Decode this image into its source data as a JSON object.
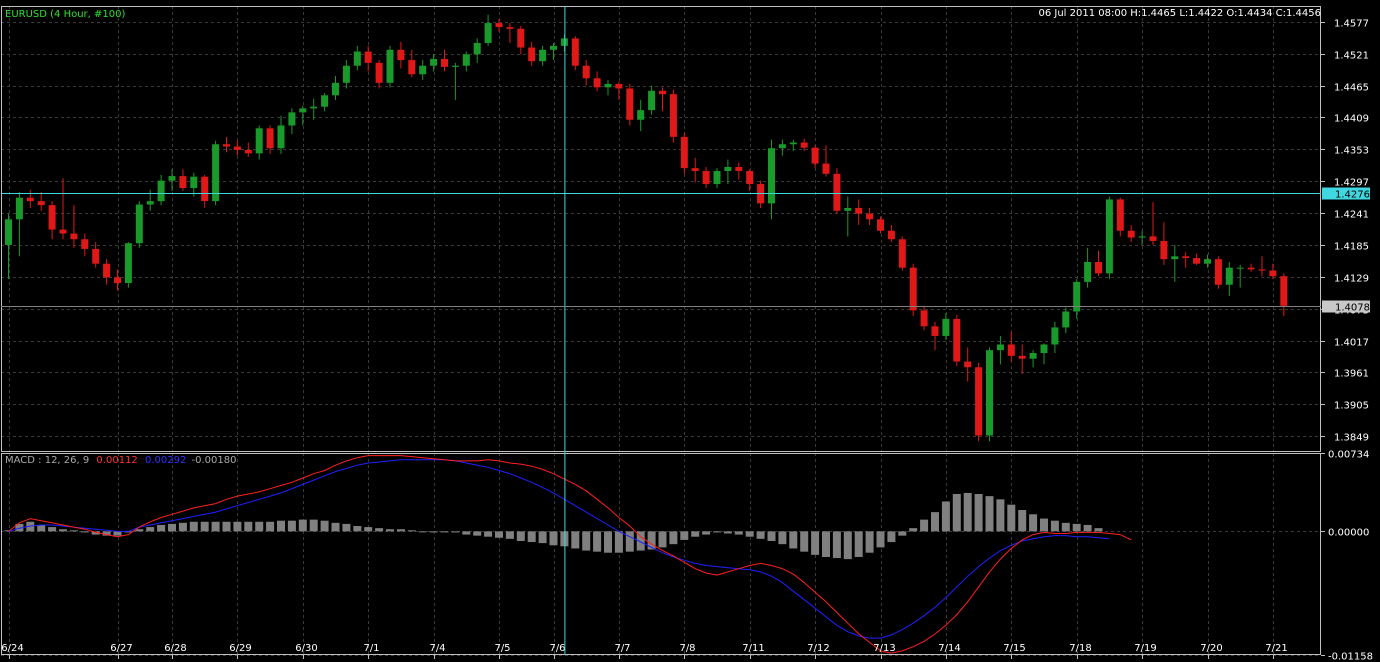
{
  "header": {
    "symbol": "EURUSD (4 Hour, #100)",
    "quote": "06 Jul 2011 08:00 H:1.4465 L:1.4422 O:1.4434 C:1.4456"
  },
  "macd_header": {
    "label": "MACD : 12, 26, 9",
    "value1": "0.00112",
    "value2": "0.00292",
    "value3": "-0.00180"
  },
  "colors": {
    "background": "#000000",
    "grid": "#3a3a3a",
    "axis": "#c0c0c0",
    "bull": "#1a9a2a",
    "bear": "#e01818",
    "crosshair": "#40d8e0",
    "macd_line": "#ff2020",
    "signal_line": "#2020ff",
    "histogram": "#808080",
    "symbol_text": "#2ee02e",
    "value_text": "#ff3030"
  },
  "chart_data": [
    {
      "type": "candlestick",
      "title": "EURUSD (4 Hour, #100)",
      "ylim": [
        1.3821,
        1.4605
      ],
      "y_ticks": [
        "1.4577",
        "1.4521",
        "1.4465",
        "1.4409",
        "1.4353",
        "1.4297",
        "1.4241",
        "1.4185",
        "1.4129",
        "1.4073",
        "1.4017",
        "1.3961",
        "1.3905",
        "1.3849"
      ],
      "x_ticks": [
        "6/24",
        "6/27",
        "6/28",
        "6/29",
        "6/30",
        "7/1",
        "7/4",
        "7/5",
        "7/6",
        "7/7",
        "7/8",
        "7/11",
        "7/12",
        "7/13",
        "7/14",
        "7/15",
        "7/18",
        "7/19",
        "7/20",
        "7/21"
      ],
      "crosshair_price": "1.4276",
      "last_price": "1.4078",
      "candles": [
        [
          1.4185,
          1.424,
          1.4125,
          1.423
        ],
        [
          1.423,
          1.4278,
          1.4165,
          1.4268
        ],
        [
          1.4268,
          1.4282,
          1.425,
          1.4262
        ],
        [
          1.4262,
          1.4278,
          1.4245,
          1.4255
        ],
        [
          1.4255,
          1.4262,
          1.4195,
          1.4212
        ],
        [
          1.4212,
          1.4302,
          1.4195,
          1.4205
        ],
        [
          1.4205,
          1.4255,
          1.418,
          1.4195
        ],
        [
          1.4195,
          1.4205,
          1.4165,
          1.4178
        ],
        [
          1.4178,
          1.419,
          1.4145,
          1.4152
        ],
        [
          1.4152,
          1.416,
          1.4115,
          1.4128
        ],
        [
          1.4128,
          1.4142,
          1.4105,
          1.4118
        ],
        [
          1.4118,
          1.419,
          1.411,
          1.4188
        ],
        [
          1.4188,
          1.4262,
          1.418,
          1.4256
        ],
        [
          1.4256,
          1.4282,
          1.4245,
          1.4262
        ],
        [
          1.4262,
          1.4308,
          1.4255,
          1.4298
        ],
        [
          1.4298,
          1.4318,
          1.428,
          1.4306
        ],
        [
          1.4306,
          1.4318,
          1.428,
          1.4285
        ],
        [
          1.4285,
          1.4312,
          1.427,
          1.4305
        ],
        [
          1.4305,
          1.4308,
          1.425,
          1.4262
        ],
        [
          1.4262,
          1.4368,
          1.4255,
          1.4362
        ],
        [
          1.4362,
          1.4375,
          1.4348,
          1.4358
        ],
        [
          1.4358,
          1.4368,
          1.4342,
          1.4352
        ],
        [
          1.4352,
          1.4365,
          1.434,
          1.4346
        ],
        [
          1.4346,
          1.4395,
          1.4335,
          1.439
        ],
        [
          1.439,
          1.4395,
          1.4345,
          1.4355
        ],
        [
          1.4355,
          1.4412,
          1.4345,
          1.4395
        ],
        [
          1.4395,
          1.4425,
          1.438,
          1.4418
        ],
        [
          1.4418,
          1.443,
          1.4395,
          1.4425
        ],
        [
          1.4425,
          1.4442,
          1.4405,
          1.4428
        ],
        [
          1.4428,
          1.4452,
          1.442,
          1.4448
        ],
        [
          1.4448,
          1.4482,
          1.444,
          1.447
        ],
        [
          1.447,
          1.451,
          1.446,
          1.45
        ],
        [
          1.45,
          1.4535,
          1.4492,
          1.4525
        ],
        [
          1.4525,
          1.4535,
          1.449,
          1.4505
        ],
        [
          1.4505,
          1.451,
          1.446,
          1.447
        ],
        [
          1.447,
          1.4535,
          1.4462,
          1.4528
        ],
        [
          1.4528,
          1.4542,
          1.4495,
          1.451
        ],
        [
          1.451,
          1.4528,
          1.448,
          1.4485
        ],
        [
          1.4485,
          1.451,
          1.4475,
          1.45
        ],
        [
          1.45,
          1.452,
          1.449,
          1.4512
        ],
        [
          1.4512,
          1.4528,
          1.449,
          1.4498
        ],
        [
          1.4498,
          1.4505,
          1.444,
          1.45
        ],
        [
          1.45,
          1.4525,
          1.449,
          1.452
        ],
        [
          1.452,
          1.4548,
          1.4505,
          1.454
        ],
        [
          1.454,
          1.459,
          1.4535,
          1.4575
        ],
        [
          1.4575,
          1.4582,
          1.456,
          1.4568
        ],
        [
          1.4568,
          1.4575,
          1.454,
          1.4565
        ],
        [
          1.4565,
          1.457,
          1.452,
          1.4532
        ],
        [
          1.4532,
          1.4542,
          1.45,
          1.4508
        ],
        [
          1.4508,
          1.4535,
          1.45,
          1.4528
        ],
        [
          1.4528,
          1.454,
          1.451,
          1.4535
        ],
        [
          1.4535,
          1.4555,
          1.4525,
          1.4548
        ],
        [
          1.4548,
          1.4552,
          1.4492,
          1.45
        ],
        [
          1.45,
          1.451,
          1.4465,
          1.4478
        ],
        [
          1.4478,
          1.449,
          1.4455,
          1.4462
        ],
        [
          1.4462,
          1.4475,
          1.4448,
          1.4468
        ],
        [
          1.4468,
          1.4472,
          1.444,
          1.446
        ],
        [
          1.446,
          1.4468,
          1.4395,
          1.4405
        ],
        [
          1.4405,
          1.444,
          1.4385,
          1.4422
        ],
        [
          1.4422,
          1.4465,
          1.4414,
          1.4456
        ],
        [
          1.4456,
          1.4462,
          1.442,
          1.445
        ],
        [
          1.445,
          1.4458,
          1.4365,
          1.4375
        ],
        [
          1.4375,
          1.4382,
          1.431,
          1.432
        ],
        [
          1.432,
          1.4338,
          1.4295,
          1.4315
        ],
        [
          1.4315,
          1.4322,
          1.4285,
          1.4292
        ],
        [
          1.4292,
          1.432,
          1.4285,
          1.4315
        ],
        [
          1.4315,
          1.4335,
          1.4292,
          1.4322
        ],
        [
          1.4322,
          1.433,
          1.43,
          1.4315
        ],
        [
          1.4315,
          1.4318,
          1.428,
          1.4292
        ],
        [
          1.4292,
          1.4298,
          1.425,
          1.4258
        ],
        [
          1.4258,
          1.437,
          1.423,
          1.4355
        ],
        [
          1.4355,
          1.437,
          1.4342,
          1.4362
        ],
        [
          1.4362,
          1.437,
          1.435,
          1.4365
        ],
        [
          1.4365,
          1.4372,
          1.435,
          1.4356
        ],
        [
          1.4356,
          1.436,
          1.432,
          1.4328
        ],
        [
          1.4328,
          1.436,
          1.4305,
          1.431
        ],
        [
          1.431,
          1.432,
          1.424,
          1.4245
        ],
        [
          1.4245,
          1.427,
          1.42,
          1.425
        ],
        [
          1.425,
          1.4265,
          1.422,
          1.424
        ],
        [
          1.424,
          1.425,
          1.422,
          1.423
        ],
        [
          1.423,
          1.4235,
          1.4205,
          1.421
        ],
        [
          1.421,
          1.422,
          1.419,
          1.4195
        ],
        [
          1.4195,
          1.42,
          1.414,
          1.4145
        ],
        [
          1.4145,
          1.4152,
          1.406,
          1.407
        ],
        [
          1.407,
          1.4078,
          1.4035,
          1.4042
        ],
        [
          1.4042,
          1.405,
          1.4,
          1.4025
        ],
        [
          1.4025,
          1.4065,
          1.4018,
          1.4055
        ],
        [
          1.4055,
          1.4062,
          1.3972,
          1.398
        ],
        [
          1.398,
          1.4005,
          1.3945,
          1.397
        ],
        [
          1.397,
          1.3978,
          1.384,
          1.385
        ],
        [
          1.385,
          1.4005,
          1.384,
          1.4
        ],
        [
          1.4,
          1.4025,
          1.3975,
          1.401
        ],
        [
          1.401,
          1.4032,
          1.398,
          1.399
        ],
        [
          1.399,
          1.401,
          1.3958,
          1.3985
        ],
        [
          1.3985,
          1.4,
          1.397,
          1.3995
        ],
        [
          1.3995,
          1.4012,
          1.3975,
          1.401
        ],
        [
          1.401,
          1.405,
          1.3995,
          1.404
        ],
        [
          1.404,
          1.4075,
          1.403,
          1.4068
        ],
        [
          1.4068,
          1.4125,
          1.4055,
          1.412
        ],
        [
          1.412,
          1.418,
          1.411,
          1.4155
        ],
        [
          1.4155,
          1.4175,
          1.413,
          1.4135
        ],
        [
          1.4135,
          1.427,
          1.4125,
          1.4265
        ],
        [
          1.4265,
          1.4268,
          1.42,
          1.421
        ],
        [
          1.421,
          1.422,
          1.419,
          1.4198
        ],
        [
          1.4198,
          1.421,
          1.4185,
          1.42
        ],
        [
          1.42,
          1.426,
          1.4185,
          1.4192
        ],
        [
          1.4192,
          1.4225,
          1.415,
          1.416
        ],
        [
          1.416,
          1.4185,
          1.412,
          1.4165
        ],
        [
          1.4165,
          1.4172,
          1.4145,
          1.4162
        ],
        [
          1.4162,
          1.417,
          1.415,
          1.4152
        ],
        [
          1.4152,
          1.4168,
          1.4145,
          1.416
        ],
        [
          1.416,
          1.4165,
          1.4108,
          1.4115
        ],
        [
          1.4115,
          1.4155,
          1.4095,
          1.4145
        ],
        [
          1.4145,
          1.415,
          1.411,
          1.4145
        ],
        [
          1.4145,
          1.4152,
          1.4138,
          1.4142
        ],
        [
          1.4142,
          1.4165,
          1.413,
          1.414
        ],
        [
          1.414,
          1.4152,
          1.4125,
          1.413
        ],
        [
          1.413,
          1.4135,
          1.406,
          1.4078
        ]
      ]
    },
    {
      "type": "macd",
      "title": "MACD : 12, 26, 9",
      "ylim": [
        -0.01158,
        0.00734
      ],
      "y_ticks": [
        "0.00734",
        "0.00000",
        "-0.01158"
      ],
      "macd": [
        0.0,
        0.0008,
        0.0012,
        0.001,
        0.0008,
        0.0006,
        0.0004,
        0.0002,
        -0.0001,
        -0.0003,
        -0.0005,
        -0.0003,
        0.0004,
        0.0009,
        0.0013,
        0.0016,
        0.0019,
        0.0022,
        0.0024,
        0.0026,
        0.003,
        0.0033,
        0.0035,
        0.0037,
        0.004,
        0.0043,
        0.0046,
        0.005,
        0.0054,
        0.0057,
        0.0062,
        0.0066,
        0.0069,
        0.0071,
        0.0071,
        0.0071,
        0.0071,
        0.007,
        0.0069,
        0.0068,
        0.0067,
        0.0066,
        0.0066,
        0.0066,
        0.0067,
        0.0066,
        0.0064,
        0.0063,
        0.0061,
        0.0058,
        0.0054,
        0.0049,
        0.0044,
        0.0038,
        0.003,
        0.0022,
        0.0013,
        0.0005,
        -0.0005,
        -0.0012,
        -0.0018,
        -0.0023,
        -0.0029,
        -0.0035,
        -0.0039,
        -0.0041,
        -0.0038,
        -0.0035,
        -0.0032,
        -0.003,
        -0.0032,
        -0.0035,
        -0.004,
        -0.0048,
        -0.0057,
        -0.0066,
        -0.0076,
        -0.0086,
        -0.0096,
        -0.0104,
        -0.0112,
        -0.0114,
        -0.0112,
        -0.0108,
        -0.0103,
        -0.0096,
        -0.0088,
        -0.0078,
        -0.0066,
        -0.0052,
        -0.0038,
        -0.0026,
        -0.0016,
        -0.0008,
        -0.0003,
        -0.0001,
        -0.0002,
        -0.0002,
        -0.0001,
        -0.0001,
        -0.0001,
        -0.0002,
        -0.0003,
        -0.0008
      ],
      "signal": [
        0.0,
        0.0003,
        0.0005,
        0.0006,
        0.0006,
        0.0005,
        0.0004,
        0.0003,
        0.0002,
        0.0001,
        0.0,
        0.0,
        0.0004,
        0.0006,
        0.0008,
        0.001,
        0.0012,
        0.0014,
        0.0016,
        0.0018,
        0.0021,
        0.0024,
        0.0027,
        0.003,
        0.0033,
        0.0036,
        0.004,
        0.0044,
        0.0048,
        0.0052,
        0.0056,
        0.0059,
        0.0062,
        0.0064,
        0.0065,
        0.0066,
        0.0067,
        0.0067,
        0.0067,
        0.0067,
        0.0067,
        0.0066,
        0.0064,
        0.0062,
        0.006,
        0.0057,
        0.0054,
        0.005,
        0.0046,
        0.0041,
        0.0036,
        0.003,
        0.0024,
        0.0018,
        0.0012,
        0.0006,
        0.0,
        -0.0005,
        -0.001,
        -0.0015,
        -0.002,
        -0.0024,
        -0.0027,
        -0.003,
        -0.0032,
        -0.0033,
        -0.0034,
        -0.0035,
        -0.0036,
        -0.0038,
        -0.0042,
        -0.0048,
        -0.0056,
        -0.0064,
        -0.0072,
        -0.008,
        -0.0088,
        -0.0094,
        -0.0098,
        -0.01,
        -0.01,
        -0.0097,
        -0.0092,
        -0.0086,
        -0.0079,
        -0.0071,
        -0.0062,
        -0.0052,
        -0.0042,
        -0.0033,
        -0.0025,
        -0.0018,
        -0.0013,
        -0.0009,
        -0.0007,
        -0.0005,
        -0.0004,
        -0.0004,
        -0.0005,
        -0.0005,
        -0.0006,
        -0.0007
      ],
      "histogram": [
        0.0001,
        0.0007,
        0.0009,
        0.0006,
        0.0004,
        0.0002,
        0.0001,
        -0.0001,
        -0.0003,
        -0.0004,
        -0.0004,
        -0.0001,
        0.0002,
        0.0004,
        0.0006,
        0.0007,
        0.0008,
        0.0009,
        0.0009,
        0.0009,
        0.0009,
        0.0009,
        0.0009,
        0.0009,
        0.0009,
        0.001,
        0.001,
        0.0011,
        0.0011,
        0.001,
        0.0008,
        0.0007,
        0.0005,
        0.0004,
        0.0003,
        0.0002,
        0.0002,
        0.0001,
        0.0,
        -0.0001,
        -0.0001,
        -0.0001,
        -0.0003,
        -0.0004,
        -0.0005,
        -0.0006,
        -0.0007,
        -0.0009,
        -0.001,
        -0.0011,
        -0.0013,
        -0.0014,
        -0.0016,
        -0.0018,
        -0.0019,
        -0.002,
        -0.002,
        -0.0019,
        -0.0018,
        -0.0017,
        -0.0015,
        -0.0012,
        -0.0008,
        -0.0005,
        -0.0003,
        -0.0001,
        -0.0002,
        -0.0003,
        -0.0005,
        -0.0007,
        -0.0009,
        -0.0012,
        -0.0016,
        -0.0019,
        -0.0022,
        -0.0024,
        -0.0025,
        -0.0026,
        -0.0024,
        -0.002,
        -0.0015,
        -0.001,
        -0.0004,
        0.0003,
        0.0011,
        0.0018,
        0.0028,
        0.0035,
        0.0036,
        0.0035,
        0.0033,
        0.003,
        0.0025,
        0.002,
        0.0016,
        0.0012,
        0.001,
        0.0008,
        0.0007,
        0.0006,
        0.0003
      ]
    }
  ]
}
